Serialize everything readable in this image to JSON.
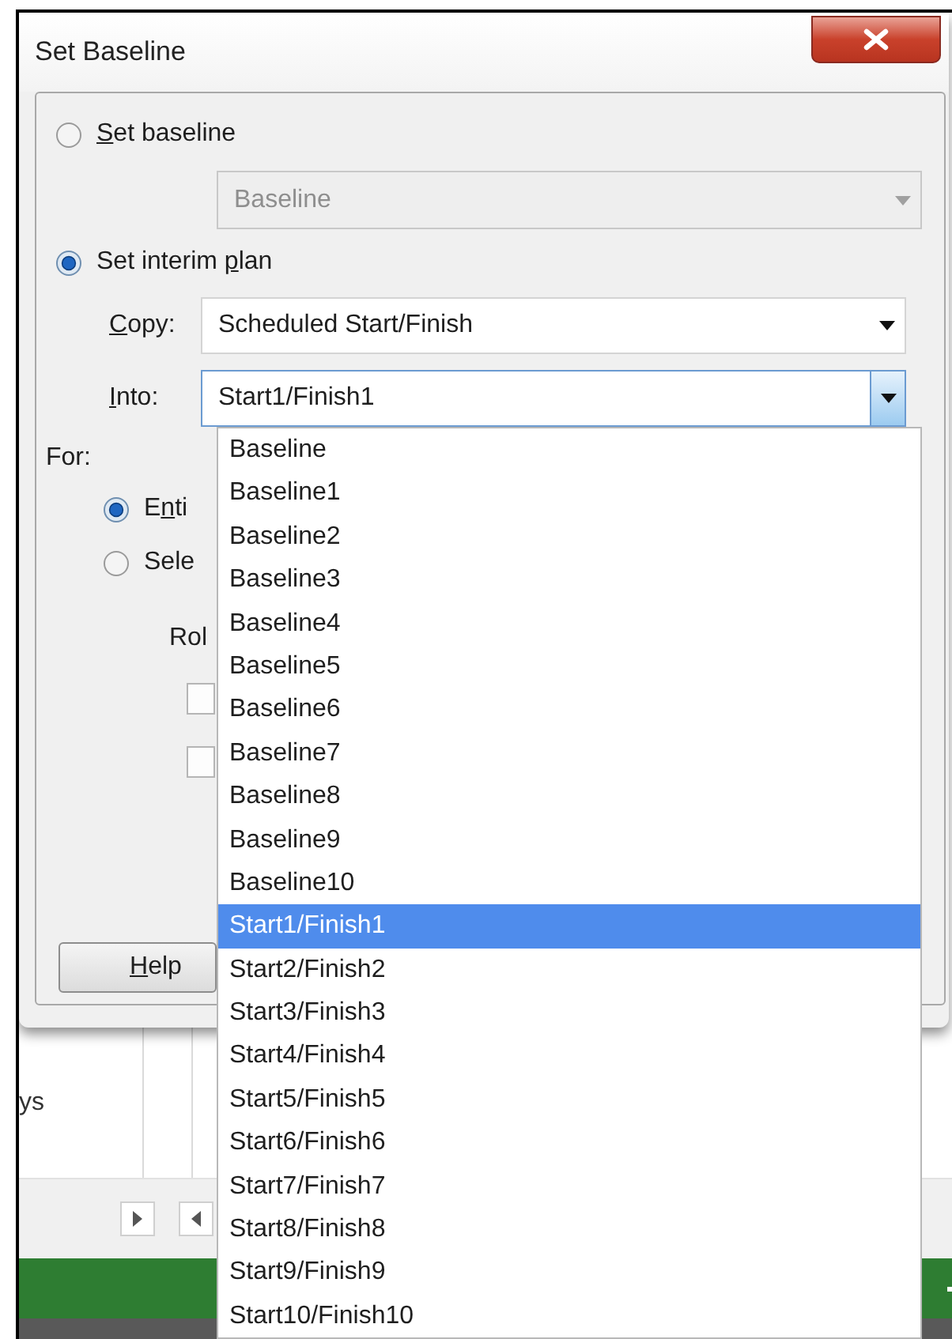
{
  "window": {
    "title": "Set Baseline"
  },
  "set_baseline": {
    "radio": {
      "label_parts": {
        "key": "S",
        "after": "et baseline"
      },
      "selected": false
    },
    "combo": {
      "value": "Baseline",
      "disabled": true,
      "expanded": false
    }
  },
  "set_interim_plan": {
    "radio": {
      "label_parts": {
        "before": "Set interim ",
        "key": "p",
        "after": "lan"
      },
      "selected": true
    },
    "copy": {
      "label_parts": {
        "key": "C",
        "after": "opy:"
      },
      "value": "Scheduled Start/Finish",
      "disabled": false,
      "expanded": false
    },
    "into": {
      "label_parts": {
        "key": "I",
        "after": "nto:"
      },
      "value": "Start1/Finish1",
      "disabled": false,
      "expanded": true,
      "options": [
        {
          "label": "Baseline",
          "selected": false
        },
        {
          "label": "Baseline1",
          "selected": false
        },
        {
          "label": "Baseline2",
          "selected": false
        },
        {
          "label": "Baseline3",
          "selected": false
        },
        {
          "label": "Baseline4",
          "selected": false
        },
        {
          "label": "Baseline5",
          "selected": false
        },
        {
          "label": "Baseline6",
          "selected": false
        },
        {
          "label": "Baseline7",
          "selected": false
        },
        {
          "label": "Baseline8",
          "selected": false
        },
        {
          "label": "Baseline9",
          "selected": false
        },
        {
          "label": "Baseline10",
          "selected": false
        },
        {
          "label": "Start1/Finish1",
          "selected": true
        },
        {
          "label": "Start2/Finish2",
          "selected": false
        },
        {
          "label": "Start3/Finish3",
          "selected": false
        },
        {
          "label": "Start4/Finish4",
          "selected": false
        },
        {
          "label": "Start5/Finish5",
          "selected": false
        },
        {
          "label": "Start6/Finish6",
          "selected": false
        },
        {
          "label": "Start7/Finish7",
          "selected": false
        },
        {
          "label": "Start8/Finish8",
          "selected": false
        },
        {
          "label": "Start9/Finish9",
          "selected": false
        },
        {
          "label": "Start10/Finish10",
          "selected": false
        }
      ]
    }
  },
  "for": {
    "label": "For:",
    "scope": [
      {
        "label_parts": {
          "before": "E",
          "key": "n",
          "after": "ti"
        },
        "selected": true
      },
      {
        "label_parts": {
          "before": "Sele"
        },
        "selected": false
      }
    ],
    "rollup": {
      "label": "Rol",
      "checkboxes": [
        {
          "checked": false
        },
        {
          "checked": false
        }
      ]
    }
  },
  "buttons": [
    {
      "label_parts": {
        "key": "H",
        "after": "elp"
      }
    }
  ],
  "background": {
    "cell_text": "ys"
  }
}
